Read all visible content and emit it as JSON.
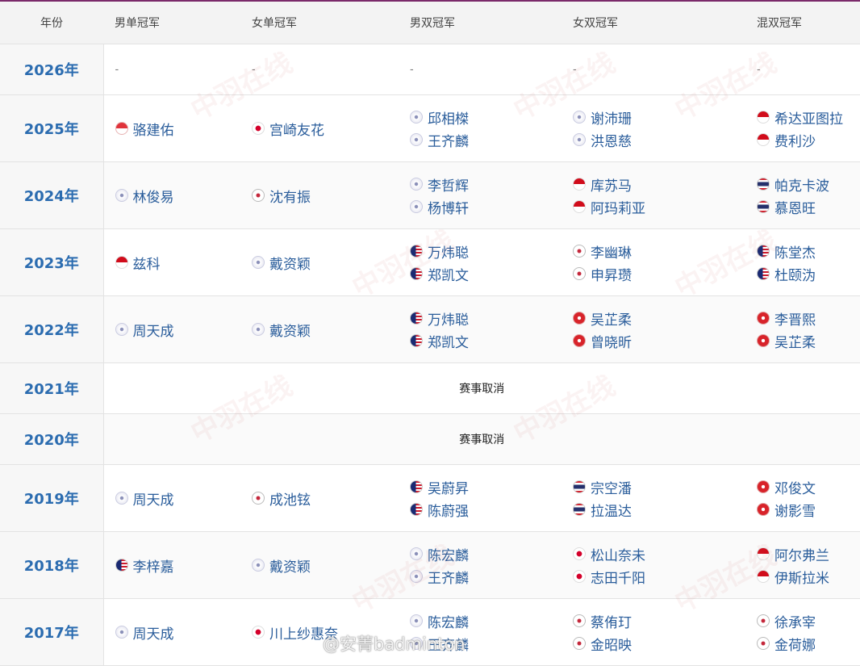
{
  "headers": {
    "year": "年份",
    "mens_singles": "男单冠军",
    "womens_singles": "女单冠军",
    "mens_doubles": "男双冠军",
    "womens_doubles": "女双冠军",
    "mixed_doubles": "混双冠军"
  },
  "rows": [
    {
      "year": "2026年",
      "ms": "-",
      "ws": "-",
      "md": "-",
      "wd": "-",
      "xd": "-"
    },
    {
      "year": "2025年",
      "ms": "骆建佑",
      "ws": "宫崎友花",
      "md1": "邱相榤",
      "md2": "王齐麟",
      "wd1": "谢沛珊",
      "wd2": "洪恩慈",
      "xd1": "希达亚图拉",
      "xd2": "费利沙"
    },
    {
      "year": "2024年",
      "ms": "林俊易",
      "ws": "沈有振",
      "md1": "李哲辉",
      "md2": "杨博轩",
      "wd1": "库苏马",
      "wd2": "阿玛莉亚",
      "xd1": "帕克卡波",
      "xd2": "慕恩旺"
    },
    {
      "year": "2023年",
      "ms": "兹科",
      "ws": "戴资颖",
      "md1": "万炜聪",
      "md2": "郑凯文",
      "wd1": "李幽琳",
      "wd2": "申昇瓒",
      "xd1": "陈堂杰",
      "xd2": "杜颐沩"
    },
    {
      "year": "2022年",
      "ms": "周天成",
      "ws": "戴资颖",
      "md1": "万炜聪",
      "md2": "郑凯文",
      "wd1": "吴芷柔",
      "wd2": "曾晓昕",
      "xd1": "李晋熙",
      "xd2": "吴芷柔"
    },
    {
      "year": "2021年",
      "cancel": "赛事取消"
    },
    {
      "year": "2020年",
      "cancel": "赛事取消"
    },
    {
      "year": "2019年",
      "ms": "周天成",
      "ws": "成池铉",
      "md1": "吴蔚昇",
      "md2": "陈蔚强",
      "wd1": "宗空潘",
      "wd2": "拉温达",
      "xd1": "邓俊文",
      "xd2": "谢影雪"
    },
    {
      "year": "2018年",
      "ms": "李梓嘉",
      "ws": "戴资颖",
      "md1": "陈宏麟",
      "md2": "王齐麟",
      "wd1": "松山奈未",
      "wd2": "志田千阳",
      "xd1": "阿尔弗兰",
      "xd2": "伊斯拉米"
    },
    {
      "year": "2017年",
      "ms": "周天成",
      "ws": "川上纱惠奈",
      "md1": "陈宏麟",
      "md2": "王齐麟",
      "wd1": "蔡侑玎",
      "wd2": "金昭映",
      "xd1": "徐承宰",
      "xd2": "金荷娜"
    }
  ],
  "watermark": "中羽在线",
  "weibo_credit": "@安菁badminton",
  "flag_icons": [
    "singapore-flag-icon",
    "japan-flag-icon",
    "chinese-taipei-flag-icon",
    "korea-flag-icon",
    "indonesia-flag-icon",
    "thailand-flag-icon",
    "malaysia-flag-icon",
    "hong-kong-flag-icon"
  ]
}
